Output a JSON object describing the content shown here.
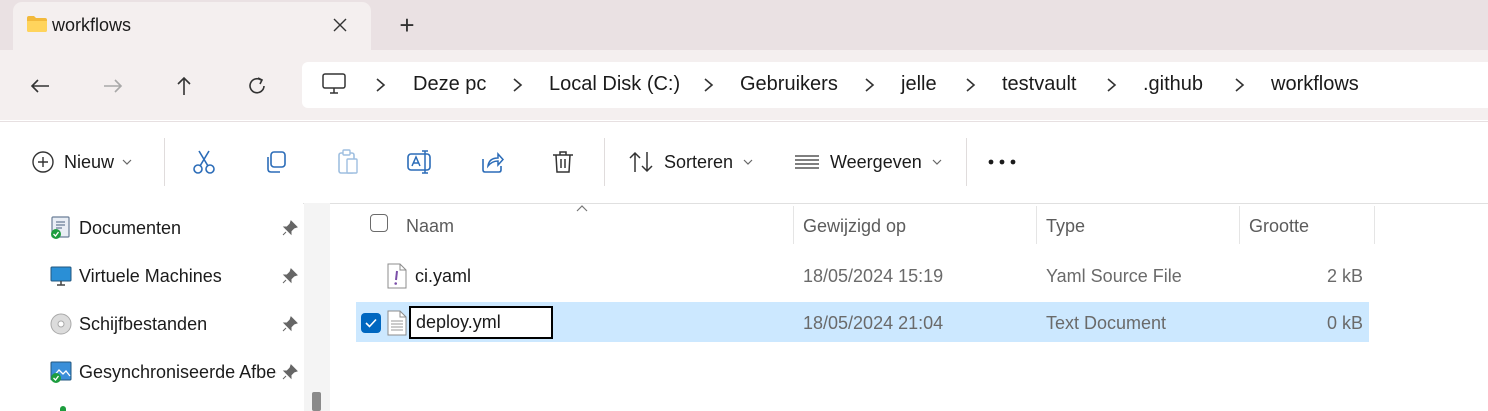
{
  "window": {
    "tab_title": "workflows",
    "tab_icon": "folder-icon",
    "new_tab_symbol": "+"
  },
  "navigation": {
    "breadcrumbs": [
      "Deze pc",
      "Local Disk (C:)",
      "Gebruikers",
      "jelle",
      "testvault",
      ".github",
      "workflows"
    ]
  },
  "commandbar": {
    "new_label": "Nieuw",
    "sort_label": "Sorteren",
    "view_label": "Weergeven",
    "more_symbol": "..."
  },
  "sidebar": {
    "items": [
      {
        "label": "Documenten",
        "icon": "documents-icon",
        "pinned": true
      },
      {
        "label": "Virtuele Machines",
        "icon": "monitor-icon",
        "pinned": true
      },
      {
        "label": "Schijfbestanden",
        "icon": "disc-icon",
        "pinned": true
      },
      {
        "label": "Gesynchroniseerde Afbeeldingen",
        "icon": "pictures-icon",
        "pinned": true
      }
    ]
  },
  "filelist": {
    "columns": [
      "Naam",
      "Gewijzigd op",
      "Type",
      "Grootte"
    ],
    "rows": [
      {
        "name": "ci.yaml",
        "modified": "18/05/2024 15:19",
        "type": "Yaml Source File",
        "size": "2 kB",
        "selected": false,
        "icon": "yaml-file-icon"
      },
      {
        "name": "deploy.yml",
        "modified": "18/05/2024 21:04",
        "type": "Text Document",
        "size": "0 kB",
        "selected": true,
        "renaming": true,
        "icon": "text-file-icon"
      }
    ]
  },
  "colors": {
    "accent": "#0067c0",
    "selection": "#cce8ff",
    "tabstrip": "#eae1e3",
    "navbar": "#f4efef"
  }
}
